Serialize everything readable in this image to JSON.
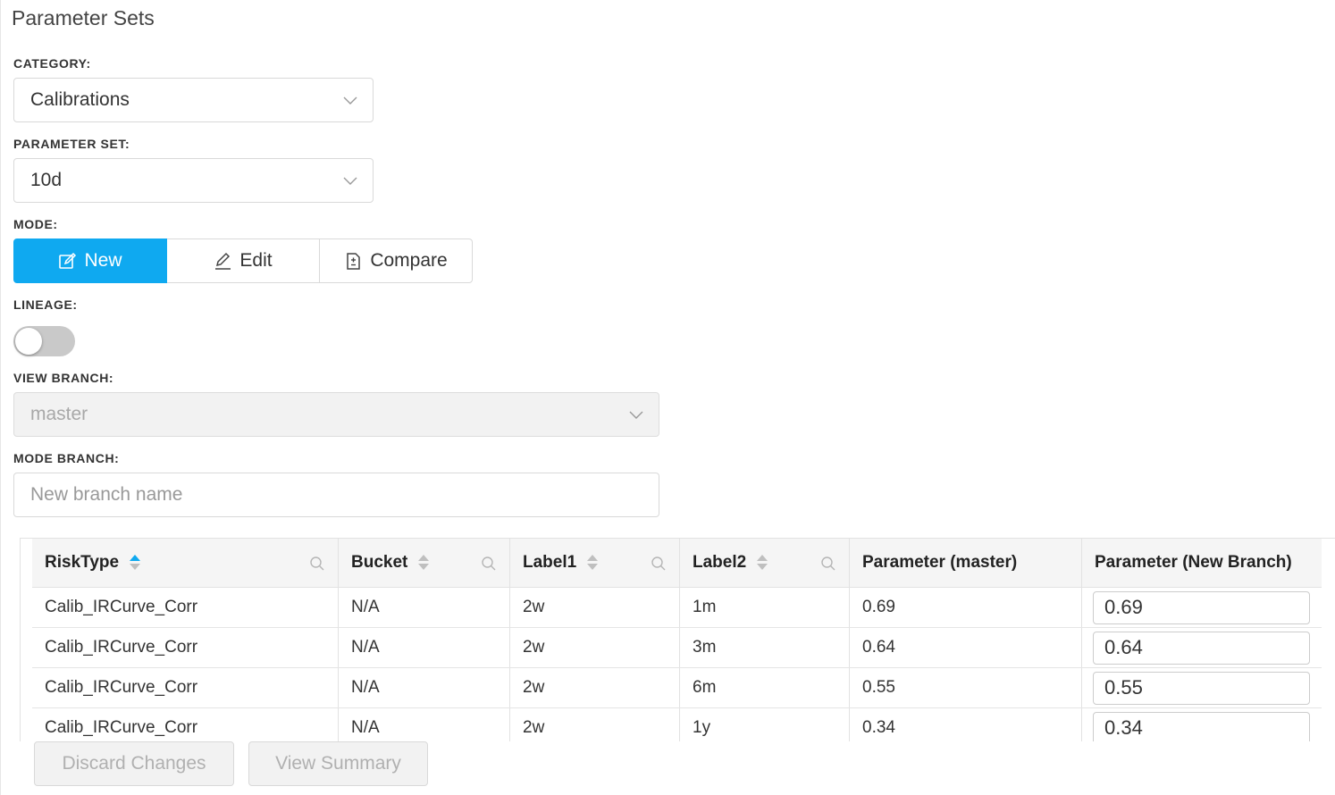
{
  "page": {
    "title": "Parameter Sets"
  },
  "category": {
    "label": "CATEGORY:",
    "value": "Calibrations"
  },
  "parameter_set": {
    "label": "PARAMETER SET:",
    "value": "10d"
  },
  "mode": {
    "label": "MODE:",
    "options": [
      {
        "label": "New",
        "icon": "edit-square-icon",
        "active": true
      },
      {
        "label": "Edit",
        "icon": "pencil-icon",
        "active": false
      },
      {
        "label": "Compare",
        "icon": "file-diff-icon",
        "active": false
      }
    ]
  },
  "lineage": {
    "label": "LINEAGE:",
    "enabled": false
  },
  "view_branch": {
    "label": "VIEW BRANCH:",
    "value": "master",
    "disabled": true
  },
  "mode_branch": {
    "label": "MODE BRANCH:",
    "placeholder": "New branch name",
    "value": ""
  },
  "table": {
    "columns": [
      {
        "label": "RiskType",
        "sort": "asc",
        "searchable": true
      },
      {
        "label": "Bucket",
        "sort": "none",
        "searchable": true
      },
      {
        "label": "Label1",
        "sort": "none",
        "searchable": true
      },
      {
        "label": "Label2",
        "sort": "none",
        "searchable": true
      },
      {
        "label": "Parameter (master)"
      },
      {
        "label": "Parameter (New Branch)"
      }
    ],
    "rows": [
      [
        "Calib_IRCurve_Corr",
        "N/A",
        "2w",
        "1m",
        "0.69",
        "0.69"
      ],
      [
        "Calib_IRCurve_Corr",
        "N/A",
        "2w",
        "3m",
        "0.64",
        "0.64"
      ],
      [
        "Calib_IRCurve_Corr",
        "N/A",
        "2w",
        "6m",
        "0.55",
        "0.55"
      ],
      [
        "Calib_IRCurve_Corr",
        "N/A",
        "2w",
        "1y",
        "0.34",
        "0.34"
      ]
    ]
  },
  "actions": {
    "discard_label": "Discard Changes",
    "summary_label": "View Summary"
  },
  "colors": {
    "accent": "#0fa9f0",
    "disabled_bg": "#f2f2f2",
    "header_bg": "#f5f5f5"
  }
}
